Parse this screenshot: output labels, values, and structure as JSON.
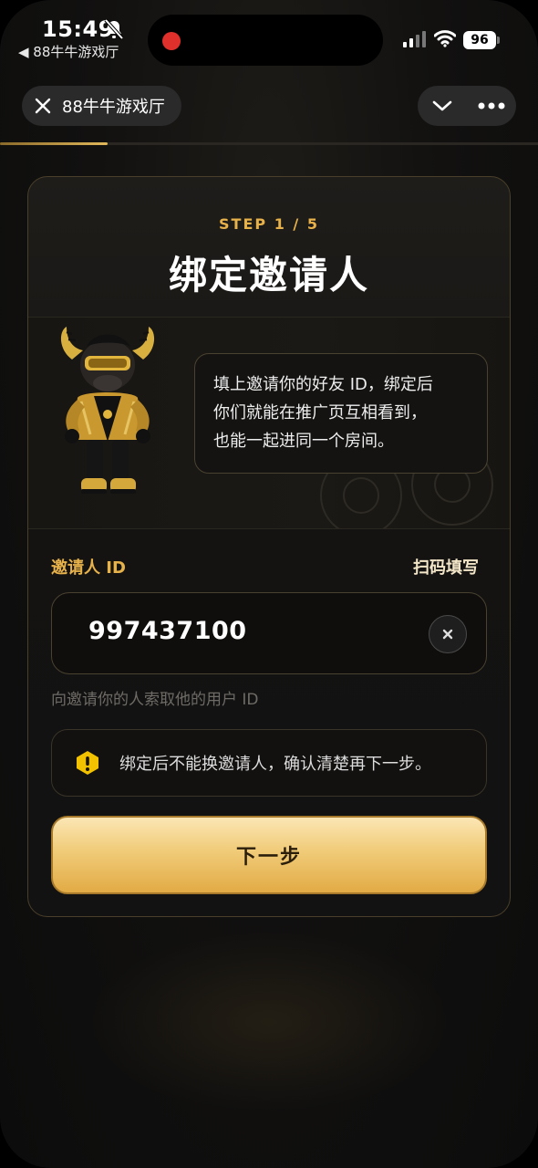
{
  "status_bar": {
    "time": "15:49",
    "back_app": "◀ 88牛牛游戏厅",
    "battery": "96"
  },
  "nav": {
    "title": "88牛牛游戏厅",
    "step_progress": 0.2
  },
  "card": {
    "step": "STEP 1 / 5",
    "title": "绑定邀请人",
    "bubble_lines": [
      "填上邀请你的好友 ID，绑定后",
      "你们就能在推广页互相看到，",
      "也能一起进同一个房间。"
    ]
  },
  "form": {
    "label": "邀请人 ID",
    "scan_link": "扫码填写",
    "inviter_id": "997437100",
    "hint": "向邀请你的人索取他的用户 ID",
    "warning": "绑定后不能换邀请人，确认清楚再下一步。",
    "next_button": "下一步"
  },
  "colors": {
    "accent": "#e8b24a",
    "button_top": "#fbe6b4",
    "button_bottom": "#e2ab45",
    "warning_icon": "#f2c200"
  }
}
